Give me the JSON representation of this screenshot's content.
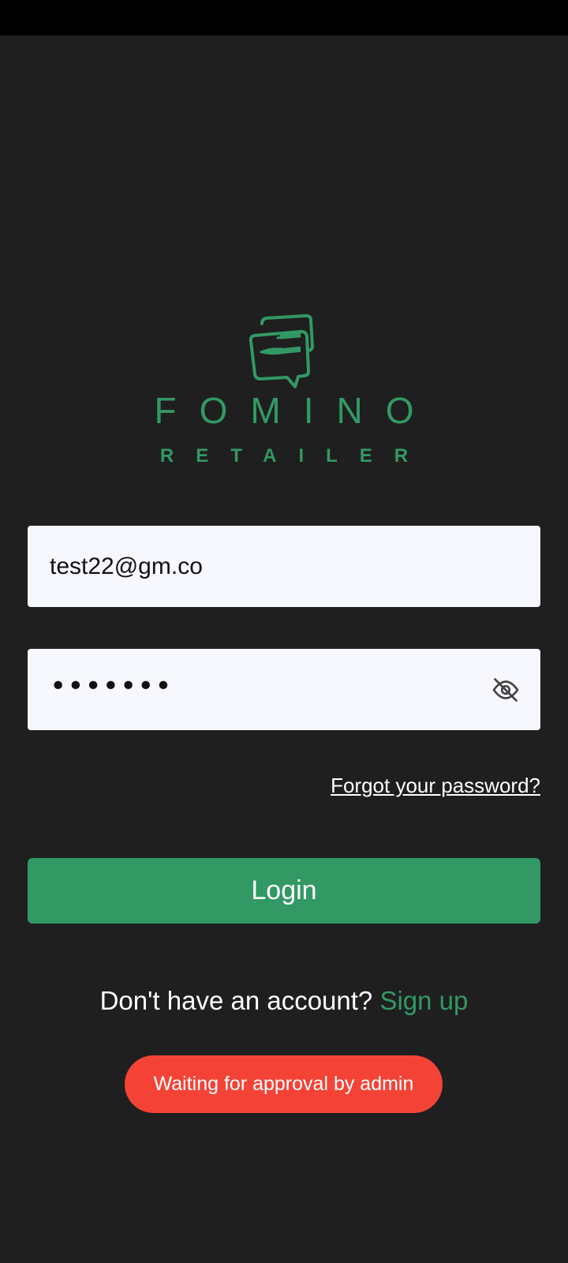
{
  "theme": {
    "background": "#1f1f1f",
    "brand_green": "#329964",
    "toast_red": "#f44336"
  },
  "brand": {
    "logo_icon": "chat-bubble-fork-knife-icon",
    "name": "FOMINO",
    "subtitle": "RETAILER"
  },
  "login_form": {
    "email_value": "test22@gm.co",
    "password_masked": "•••••••",
    "password_toggle_icon": "eye-off-icon",
    "forgot_label": "Forgot your password?",
    "login_label": "Login"
  },
  "signup": {
    "prompt": "Don't have an account?",
    "link_label": "Sign up"
  },
  "toast": {
    "message": "Waiting for approval by admin"
  }
}
